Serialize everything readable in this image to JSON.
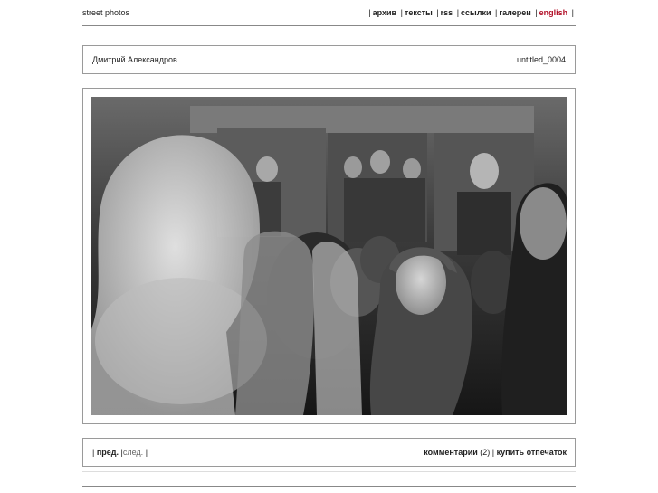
{
  "header": {
    "site_title": "street photos",
    "nav": [
      {
        "label": "архив"
      },
      {
        "label": "тексты"
      },
      {
        "label": "rss"
      },
      {
        "label": "ссылки"
      },
      {
        "label": "галереи"
      },
      {
        "label": "english"
      }
    ],
    "separator": "|"
  },
  "info": {
    "author": "Дмитрий Александров",
    "photo_title": "untitled_0004"
  },
  "photo": {
    "content": "black-and-white street photograph"
  },
  "footer_nav": {
    "prev_label": "пред.",
    "next_label": "след.",
    "comments_label": "комментарии",
    "comments_count": "(2)",
    "buy_print_label": "купить отпечаток",
    "separator": "|"
  },
  "colors": {
    "accent": "#b3122a",
    "border": "#9a9a9a"
  }
}
